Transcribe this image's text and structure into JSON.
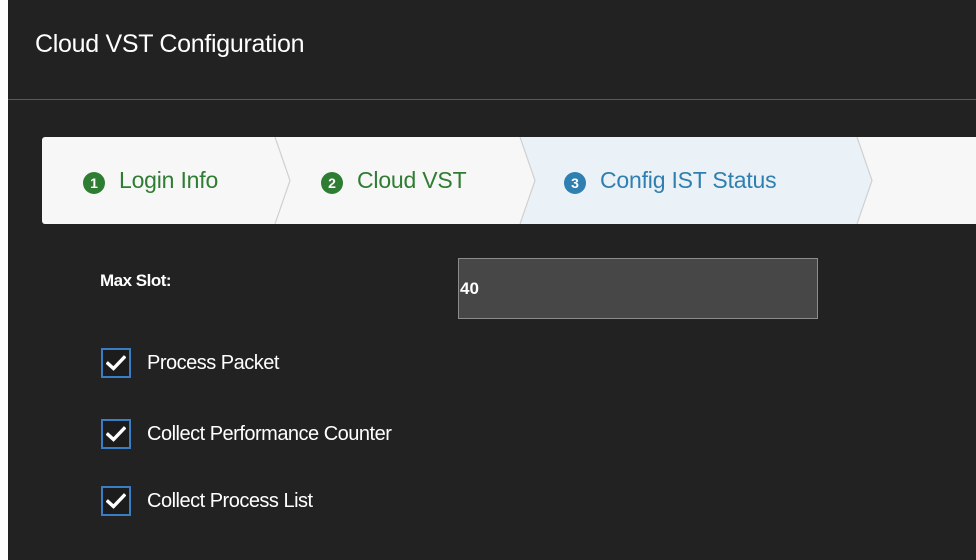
{
  "dialog": {
    "title": "Cloud VST Configuration"
  },
  "wizard": {
    "steps": [
      {
        "number": "1",
        "label": "Login Info",
        "state": "completed"
      },
      {
        "number": "2",
        "label": "Cloud VST",
        "state": "completed"
      },
      {
        "number": "3",
        "label": "Config IST Status",
        "state": "active"
      }
    ]
  },
  "form": {
    "max_slot": {
      "label": "Max Slot:",
      "value": "40"
    },
    "checkboxes": [
      {
        "label": "Process Packet",
        "checked": true
      },
      {
        "label": "Collect Performance Counter",
        "checked": true
      },
      {
        "label": "Collect Process List",
        "checked": true
      }
    ]
  },
  "colors": {
    "background": "#222222",
    "completed_step": "#2e7d32",
    "active_step": "#2f7fb0",
    "checkbox_border": "#3b7dc4"
  },
  "icons": {
    "checkbox": "checkmark-icon"
  }
}
